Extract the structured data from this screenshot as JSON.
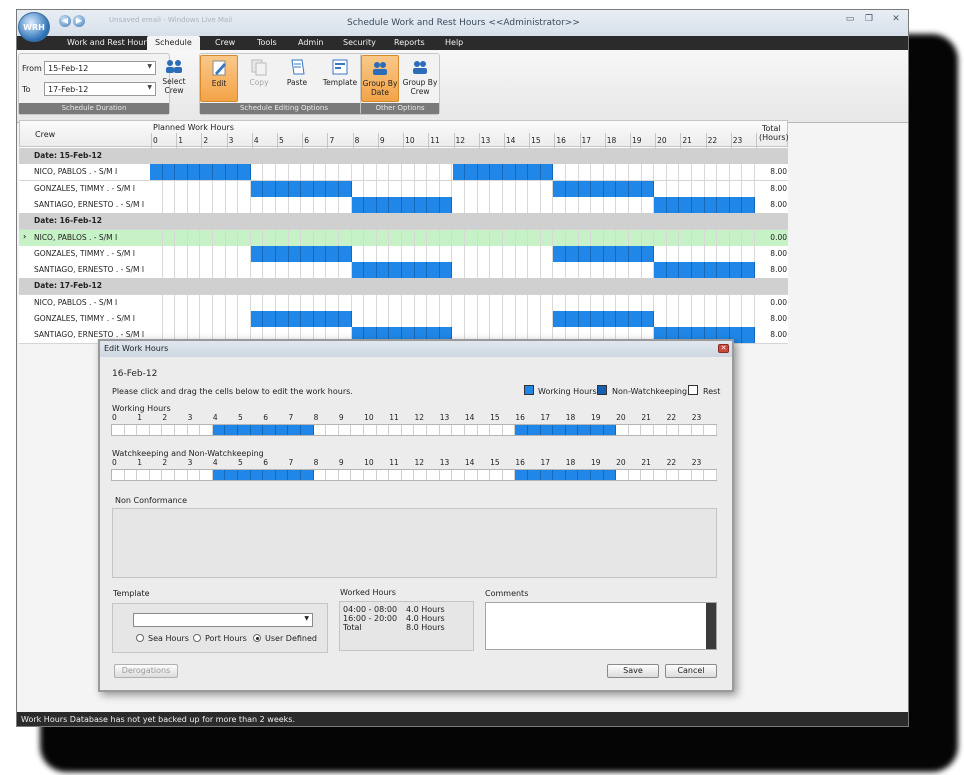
{
  "window": {
    "title": "Schedule Work and Rest Hours <<Administrator>>",
    "logo": "WRH",
    "qat_faded_text": "Unsaved email - Windows Live Mail"
  },
  "menu": [
    "Work and Rest Hours",
    "Schedule",
    "Crew",
    "Tools",
    "Admin",
    "Security",
    "Reports",
    "Help"
  ],
  "ribbon": {
    "from_label": "From",
    "from_value": "15-Feb-12",
    "to_label": "To",
    "to_value": "17-Feb-12",
    "select_crew": "Select Crew",
    "group_duration": "Schedule Duration",
    "edit": "Edit",
    "copy": "Copy",
    "paste": "Paste",
    "template": "Template",
    "group_editing": "Schedule Editing Options",
    "group_by_date": "Group By Date",
    "group_by_crew": "Group By Crew",
    "group_other": "Other Options"
  },
  "grid": {
    "crew_header": "Crew",
    "planned_header": "Planned Work Hours",
    "total_header": "Total",
    "total_sub": "(Hours)",
    "hours": [
      "0",
      "1",
      "2",
      "3",
      "4",
      "5",
      "6",
      "7",
      "8",
      "9",
      "10",
      "11",
      "12",
      "13",
      "14",
      "15",
      "16",
      "17",
      "18",
      "19",
      "20",
      "21",
      "22",
      "23"
    ],
    "rows": [
      {
        "type": "date",
        "name": "Date: 15-Feb-12"
      },
      {
        "type": "crew",
        "name": "NICO, PABLOS . - S/M I",
        "total": "8.00",
        "work": [
          [
            0,
            4
          ],
          [
            12,
            16
          ]
        ]
      },
      {
        "type": "crew",
        "name": "GONZALES, TIMMY . - S/M I",
        "total": "8.00",
        "work": [
          [
            4,
            8
          ],
          [
            16,
            20
          ]
        ]
      },
      {
        "type": "crew",
        "name": "SANTIAGO, ERNESTO . - S/M I",
        "total": "8.00",
        "work": [
          [
            8,
            12
          ],
          [
            20,
            24
          ]
        ]
      },
      {
        "type": "date",
        "name": "Date: 16-Feb-12"
      },
      {
        "type": "crew",
        "name": "NICO, PABLOS . - S/M I",
        "total": "0.00",
        "work": [],
        "selected": true
      },
      {
        "type": "crew",
        "name": "GONZALES, TIMMY . - S/M I",
        "total": "8.00",
        "work": [
          [
            4,
            8
          ],
          [
            16,
            20
          ]
        ]
      },
      {
        "type": "crew",
        "name": "SANTIAGO, ERNESTO . - S/M I",
        "total": "8.00",
        "work": [
          [
            8,
            12
          ],
          [
            20,
            24
          ]
        ]
      },
      {
        "type": "date",
        "name": "Date: 17-Feb-12"
      },
      {
        "type": "crew",
        "name": "NICO, PABLOS . - S/M I",
        "total": "0.00",
        "work": []
      },
      {
        "type": "crew",
        "name": "GONZALES, TIMMY . - S/M I",
        "total": "8.00",
        "work": [
          [
            4,
            8
          ],
          [
            16,
            20
          ]
        ]
      },
      {
        "type": "crew",
        "name": "SANTIAGO, ERNESTO . - S/M I",
        "total": "8.00",
        "work": [
          [
            8,
            12
          ],
          [
            20,
            24
          ]
        ]
      }
    ]
  },
  "dialog": {
    "title": "Edit Work Hours",
    "date": "16-Feb-12",
    "instruction": "Please click and drag the cells below to edit the work hours.",
    "legend": {
      "working": "Working Hours",
      "nonwatch": "Non-Watchkeeping",
      "rest": "Rest"
    },
    "working_label": "Working Hours",
    "watch_label": "Watchkeeping and Non-Watchkeeping",
    "hours": [
      "0",
      "1",
      "2",
      "3",
      "4",
      "5",
      "6",
      "7",
      "8",
      "9",
      "10",
      "11",
      "12",
      "13",
      "14",
      "15",
      "16",
      "17",
      "18",
      "19",
      "20",
      "21",
      "22",
      "23"
    ],
    "work_ranges": [
      [
        4,
        8
      ],
      [
        16,
        20
      ]
    ],
    "non_conformance": "Non Conformance",
    "template_label": "Template",
    "template_value": "",
    "radios": [
      "Sea Hours",
      "Port Hours",
      "User Defined"
    ],
    "selected_radio": "User Defined",
    "worked_label": "Worked Hours",
    "worked_rows": [
      [
        "04:00 - 08:00",
        "4.0 Hours"
      ],
      [
        "16:00 - 20:00",
        "4.0 Hours"
      ],
      [
        "Total",
        "8.0 Hours"
      ]
    ],
    "comments_label": "Comments",
    "derogations": "Derogations",
    "save": "Save",
    "cancel": "Cancel"
  },
  "status": "Work Hours Database has not yet backed up for more than 2 weeks.",
  "colors": {
    "work_blue": "#2087e8",
    "nonwatch_blue": "#1660b0",
    "selected_row": "#c7f2c7",
    "active_button": "#f4a347"
  }
}
